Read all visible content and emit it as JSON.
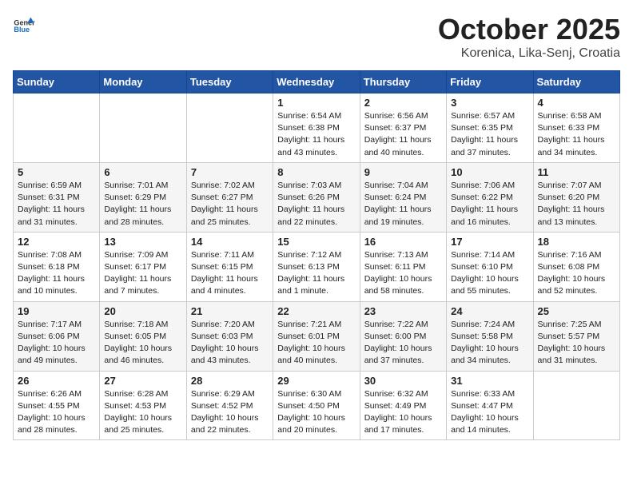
{
  "header": {
    "logo_general": "General",
    "logo_blue": "Blue",
    "month": "October 2025",
    "location": "Korenica, Lika-Senj, Croatia"
  },
  "weekdays": [
    "Sunday",
    "Monday",
    "Tuesday",
    "Wednesday",
    "Thursday",
    "Friday",
    "Saturday"
  ],
  "weeks": [
    [
      {
        "day": "",
        "info": ""
      },
      {
        "day": "",
        "info": ""
      },
      {
        "day": "",
        "info": ""
      },
      {
        "day": "1",
        "info": "Sunrise: 6:54 AM\nSunset: 6:38 PM\nDaylight: 11 hours\nand 43 minutes."
      },
      {
        "day": "2",
        "info": "Sunrise: 6:56 AM\nSunset: 6:37 PM\nDaylight: 11 hours\nand 40 minutes."
      },
      {
        "day": "3",
        "info": "Sunrise: 6:57 AM\nSunset: 6:35 PM\nDaylight: 11 hours\nand 37 minutes."
      },
      {
        "day": "4",
        "info": "Sunrise: 6:58 AM\nSunset: 6:33 PM\nDaylight: 11 hours\nand 34 minutes."
      }
    ],
    [
      {
        "day": "5",
        "info": "Sunrise: 6:59 AM\nSunset: 6:31 PM\nDaylight: 11 hours\nand 31 minutes."
      },
      {
        "day": "6",
        "info": "Sunrise: 7:01 AM\nSunset: 6:29 PM\nDaylight: 11 hours\nand 28 minutes."
      },
      {
        "day": "7",
        "info": "Sunrise: 7:02 AM\nSunset: 6:27 PM\nDaylight: 11 hours\nand 25 minutes."
      },
      {
        "day": "8",
        "info": "Sunrise: 7:03 AM\nSunset: 6:26 PM\nDaylight: 11 hours\nand 22 minutes."
      },
      {
        "day": "9",
        "info": "Sunrise: 7:04 AM\nSunset: 6:24 PM\nDaylight: 11 hours\nand 19 minutes."
      },
      {
        "day": "10",
        "info": "Sunrise: 7:06 AM\nSunset: 6:22 PM\nDaylight: 11 hours\nand 16 minutes."
      },
      {
        "day": "11",
        "info": "Sunrise: 7:07 AM\nSunset: 6:20 PM\nDaylight: 11 hours\nand 13 minutes."
      }
    ],
    [
      {
        "day": "12",
        "info": "Sunrise: 7:08 AM\nSunset: 6:18 PM\nDaylight: 11 hours\nand 10 minutes."
      },
      {
        "day": "13",
        "info": "Sunrise: 7:09 AM\nSunset: 6:17 PM\nDaylight: 11 hours\nand 7 minutes."
      },
      {
        "day": "14",
        "info": "Sunrise: 7:11 AM\nSunset: 6:15 PM\nDaylight: 11 hours\nand 4 minutes."
      },
      {
        "day": "15",
        "info": "Sunrise: 7:12 AM\nSunset: 6:13 PM\nDaylight: 11 hours\nand 1 minute."
      },
      {
        "day": "16",
        "info": "Sunrise: 7:13 AM\nSunset: 6:11 PM\nDaylight: 10 hours\nand 58 minutes."
      },
      {
        "day": "17",
        "info": "Sunrise: 7:14 AM\nSunset: 6:10 PM\nDaylight: 10 hours\nand 55 minutes."
      },
      {
        "day": "18",
        "info": "Sunrise: 7:16 AM\nSunset: 6:08 PM\nDaylight: 10 hours\nand 52 minutes."
      }
    ],
    [
      {
        "day": "19",
        "info": "Sunrise: 7:17 AM\nSunset: 6:06 PM\nDaylight: 10 hours\nand 49 minutes."
      },
      {
        "day": "20",
        "info": "Sunrise: 7:18 AM\nSunset: 6:05 PM\nDaylight: 10 hours\nand 46 minutes."
      },
      {
        "day": "21",
        "info": "Sunrise: 7:20 AM\nSunset: 6:03 PM\nDaylight: 10 hours\nand 43 minutes."
      },
      {
        "day": "22",
        "info": "Sunrise: 7:21 AM\nSunset: 6:01 PM\nDaylight: 10 hours\nand 40 minutes."
      },
      {
        "day": "23",
        "info": "Sunrise: 7:22 AM\nSunset: 6:00 PM\nDaylight: 10 hours\nand 37 minutes."
      },
      {
        "day": "24",
        "info": "Sunrise: 7:24 AM\nSunset: 5:58 PM\nDaylight: 10 hours\nand 34 minutes."
      },
      {
        "day": "25",
        "info": "Sunrise: 7:25 AM\nSunset: 5:57 PM\nDaylight: 10 hours\nand 31 minutes."
      }
    ],
    [
      {
        "day": "26",
        "info": "Sunrise: 6:26 AM\nSunset: 4:55 PM\nDaylight: 10 hours\nand 28 minutes."
      },
      {
        "day": "27",
        "info": "Sunrise: 6:28 AM\nSunset: 4:53 PM\nDaylight: 10 hours\nand 25 minutes."
      },
      {
        "day": "28",
        "info": "Sunrise: 6:29 AM\nSunset: 4:52 PM\nDaylight: 10 hours\nand 22 minutes."
      },
      {
        "day": "29",
        "info": "Sunrise: 6:30 AM\nSunset: 4:50 PM\nDaylight: 10 hours\nand 20 minutes."
      },
      {
        "day": "30",
        "info": "Sunrise: 6:32 AM\nSunset: 4:49 PM\nDaylight: 10 hours\nand 17 minutes."
      },
      {
        "day": "31",
        "info": "Sunrise: 6:33 AM\nSunset: 4:47 PM\nDaylight: 10 hours\nand 14 minutes."
      },
      {
        "day": "",
        "info": ""
      }
    ]
  ]
}
